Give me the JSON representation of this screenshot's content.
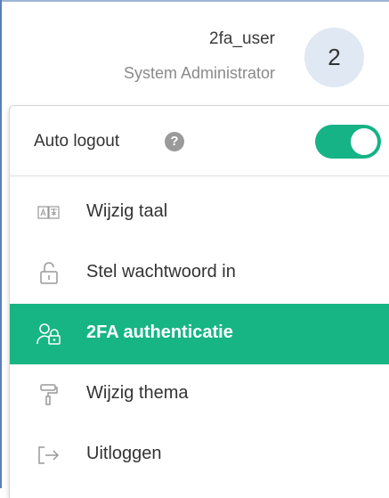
{
  "user": {
    "name": "2fa_user",
    "role": "System Administrator",
    "avatar_text": "2"
  },
  "auto_logout": {
    "label": "Auto logout",
    "help_icon": "question-circle-icon",
    "help_glyph": "?",
    "enabled": true
  },
  "menu": {
    "items": [
      {
        "label": "Wijzig taal",
        "icon": "language-icon"
      },
      {
        "label": "Stel wachtwoord in",
        "icon": "unlock-icon"
      },
      {
        "label": "2FA authenticatie",
        "icon": "user-lock-icon",
        "active": true
      },
      {
        "label": "Wijzig thema",
        "icon": "paint-roller-icon"
      },
      {
        "label": "Uitloggen",
        "icon": "logout-icon"
      }
    ]
  },
  "colors": {
    "accent": "#17b584",
    "avatar_bg": "#dfe8f3",
    "text": "#333333",
    "muted": "#8a8a8a"
  }
}
